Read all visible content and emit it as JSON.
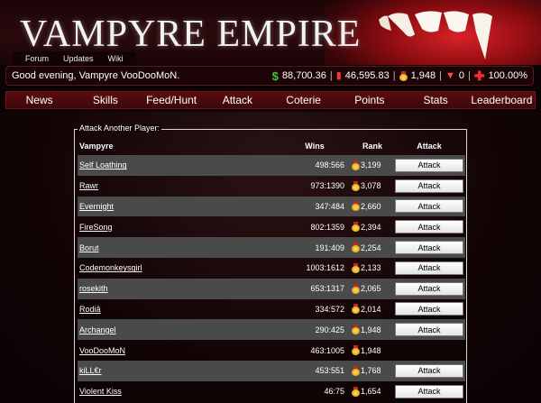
{
  "header": {
    "logo": "VAMPYRE EMPIRE",
    "topnav": [
      "Forum",
      "Updates",
      "Wiki"
    ]
  },
  "status": {
    "greeting": "Good evening, Vampyre VooDooMoN.",
    "cash": "88,700.36",
    "bank": "46,595.83",
    "rank": "1,948",
    "hearts": "0",
    "health": "100.00%"
  },
  "mainnav": [
    "News",
    "Skills",
    "Feed/Hunt",
    "Attack",
    "Coterie",
    "Points",
    "Stats",
    "Leaderboard"
  ],
  "attack": {
    "legend": "Attack Another Player:",
    "columns": {
      "vampyre": "Vampyre",
      "wins": "Wins",
      "rank": "Rank",
      "attack": "Attack"
    },
    "button_label": "Attack",
    "rows": [
      {
        "name": "Self Loathing",
        "wins": "498:566",
        "rank": "3,199",
        "button": true
      },
      {
        "name": "Rawr",
        "wins": "973:1390",
        "rank": "3,078",
        "button": true
      },
      {
        "name": "Evernight",
        "wins": "347:484",
        "rank": "2,660",
        "button": true
      },
      {
        "name": "FireSong",
        "wins": "802:1359",
        "rank": "2,394",
        "button": true
      },
      {
        "name": "Borut",
        "wins": "191:409",
        "rank": "2,254",
        "button": true
      },
      {
        "name": "Codemonkeysgirl",
        "wins": "1003:1612",
        "rank": "2,133",
        "button": true
      },
      {
        "name": "rosekith",
        "wins": "653:1317",
        "rank": "2,065",
        "button": true
      },
      {
        "name": "Rodiâ",
        "wins": "334:572",
        "rank": "2,014",
        "button": true
      },
      {
        "name": "Archangel",
        "wins": "290:425",
        "rank": "1,948",
        "button": true
      },
      {
        "name": "VooDooMoN",
        "wins": "463:1005",
        "rank": "1,948",
        "button": false
      },
      {
        "name": "kiLL€r",
        "wins": "453:551",
        "rank": "1,768",
        "button": true
      },
      {
        "name": "Violent Kiss",
        "wins": "46:75",
        "rank": "1,654",
        "button": true
      }
    ]
  }
}
